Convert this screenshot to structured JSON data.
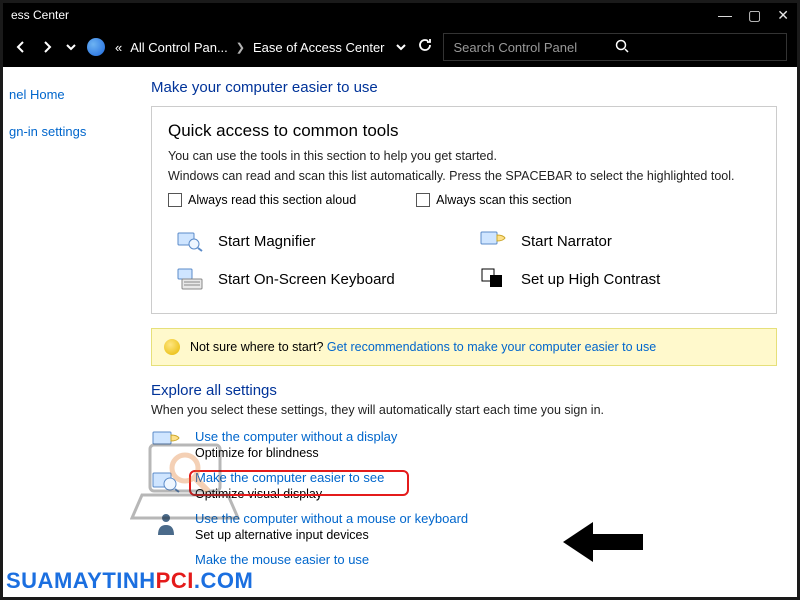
{
  "titlebar": {
    "title": "ess Center"
  },
  "nav": {
    "crumb1_prefix": "«",
    "crumb1": "All Control Pan...",
    "crumb2": "Ease of Access Center",
    "search_placeholder": "Search Control Panel"
  },
  "sidebar": {
    "home": "nel Home",
    "signin": "gn-in settings"
  },
  "main": {
    "heading": "Make your computer easier to use",
    "box": {
      "title": "Quick access to common tools",
      "line1": "You can use the tools in this section to help you get started.",
      "line2": "Windows can read and scan this list automatically.  Press the SPACEBAR to select the highlighted tool.",
      "chk1": "Always read this section aloud",
      "chk2": "Always scan this section",
      "tool_magnifier": "Start Magnifier",
      "tool_narrator": "Start Narrator",
      "tool_osk": "Start On-Screen Keyboard",
      "tool_contrast": "Set up High Contrast"
    },
    "hint": {
      "prefix": "Not sure where to start? ",
      "link": "Get recommendations to make your computer easier to use"
    },
    "explore": {
      "heading": "Explore all settings",
      "sub": "When you select these settings, they will automatically start each time you sign in."
    },
    "settings": {
      "r1_link": "Use the computer without a display",
      "r1_desc": "Optimize for blindness",
      "r2_link": "Make the computer easier to see",
      "r2_desc": "Optimize visual display",
      "r3_link": "Use the computer without a mouse or keyboard",
      "r3_desc": "Set up alternative input devices",
      "r4_link": "Make the mouse easier to use"
    }
  },
  "watermark": {
    "a": "SUAMAYTINH",
    "b": "PCI",
    "c": ".COM"
  }
}
